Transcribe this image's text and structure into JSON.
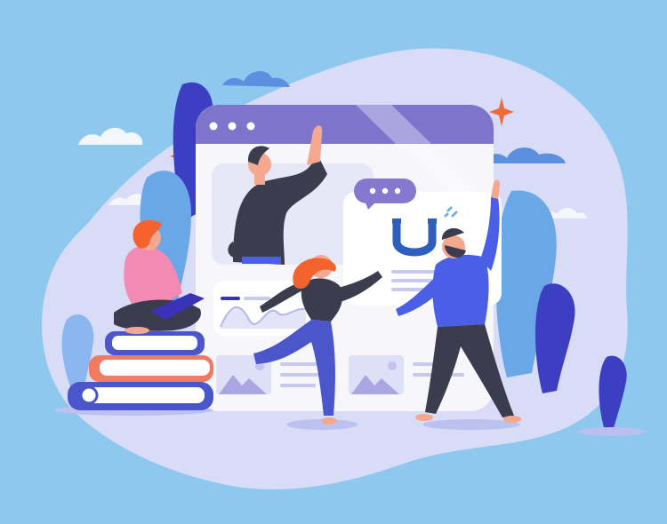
{
  "illustration": {
    "colors": {
      "background": "#8ec8ef",
      "blob": "#d8dcf6",
      "window_header": "#7f74cc",
      "window_body": "#f6f6fb",
      "panel": "#e7e8f7",
      "accent_purple": "#8678cf",
      "accent_blue": "#4a5ee6",
      "dark_blue": "#3a32b8",
      "orange": "#f06a3a",
      "pink": "#f38ab3",
      "hair": "#f4622e",
      "dark": "#3b3d4f",
      "cloud": "#f3f6fb",
      "leaf_light": "#6aa7e6",
      "leaf_dark": "#3d3fc2",
      "book_red": "#f27a62",
      "book_blue": "#4a56c9"
    },
    "icons": [
      "browser-window",
      "speech-bubble",
      "magnet-icon",
      "image-placeholder-icon",
      "stack-of-books",
      "laptop",
      "cloud",
      "sparkle-star",
      "plant"
    ]
  }
}
